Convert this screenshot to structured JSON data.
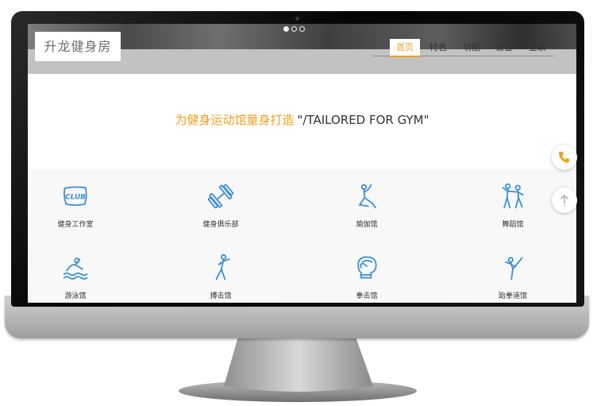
{
  "site": {
    "logo": "升龙健身房"
  },
  "carousel": {
    "dot_count": 3,
    "active_index": 0
  },
  "nav": {
    "items": [
      {
        "label": "首页",
        "active": true
      },
      {
        "label": "特色",
        "active": false
      },
      {
        "label": "功能",
        "active": false
      },
      {
        "label": "设备",
        "active": false
      },
      {
        "label": "登录",
        "active": false
      }
    ]
  },
  "hero": {
    "title_cn": "为健身运动馆量身打造",
    "title_en": "\"/TAILORED FOR GYM\""
  },
  "features": {
    "items": [
      {
        "label": "健身工作室",
        "icon": "club-badge-icon",
        "icon_text": "CLUB"
      },
      {
        "label": "健身俱乐部",
        "icon": "dumbbell-icon"
      },
      {
        "label": "瑜伽馆",
        "icon": "yoga-pose-icon"
      },
      {
        "label": "舞蹈馆",
        "icon": "dancers-icon"
      },
      {
        "label": "游泳馆",
        "icon": "swimmer-icon"
      },
      {
        "label": "搏击馆",
        "icon": "fighter-icon"
      },
      {
        "label": "拳击馆",
        "icon": "boxing-glove-icon"
      },
      {
        "label": "跆拳道馆",
        "icon": "taekwondo-kick-icon"
      }
    ]
  },
  "floating": {
    "phone_icon": "phone-icon",
    "top_icon": "arrow-up-icon"
  },
  "colors": {
    "accent": "#f0a020",
    "icon": "#3a8fd9",
    "text": "#333333",
    "section_bg": "#f8f8f8"
  }
}
